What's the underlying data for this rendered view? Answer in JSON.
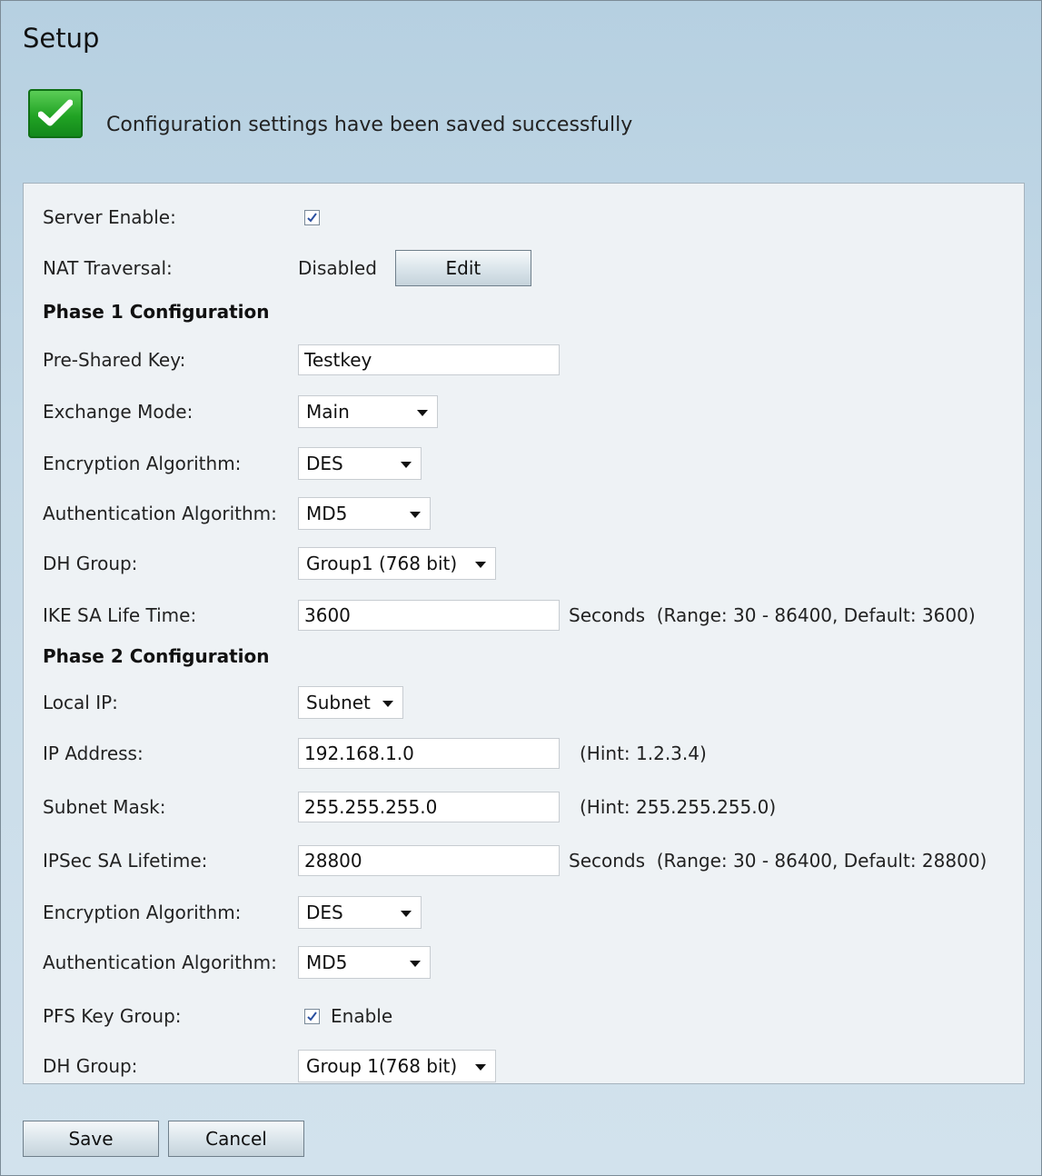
{
  "page": {
    "title": "Setup"
  },
  "banner": {
    "message": "Configuration settings have been saved successfully",
    "icon": "check-icon"
  },
  "general": {
    "server_enable_label": "Server Enable:",
    "server_enable_checked": true,
    "nat_label": "NAT Traversal:",
    "nat_status": "Disabled",
    "nat_edit": "Edit"
  },
  "phase1": {
    "heading": "Phase 1 Configuration",
    "psk_label": "Pre-Shared Key:",
    "psk_value": "Testkey",
    "exchange_label": "Exchange Mode:",
    "exchange_value": "Main",
    "enc_label": "Encryption Algorithm:",
    "enc_value": "DES",
    "auth_label": "Authentication Algorithm:",
    "auth_value": "MD5",
    "dh_label": "DH Group:",
    "dh_value": "Group1 (768 bit)",
    "ike_label": "IKE SA Life Time:",
    "ike_value": "3600",
    "ike_hint": "Seconds  (Range: 30 - 86400, Default: 3600)"
  },
  "phase2": {
    "heading": "Phase 2 Configuration",
    "localip_label": "Local IP:",
    "localip_value": "Subnet",
    "ip_label": "IP Address:",
    "ip_value": "192.168.1.0",
    "ip_hint": "(Hint: 1.2.3.4)",
    "mask_label": "Subnet Mask:",
    "mask_value": "255.255.255.0",
    "mask_hint": "(Hint: 255.255.255.0)",
    "ipsec_label": "IPSec SA Lifetime:",
    "ipsec_value": "28800",
    "ipsec_hint": "Seconds  (Range: 30 - 86400, Default: 28800)",
    "enc_label": "Encryption Algorithm:",
    "enc_value": "DES",
    "auth_label": "Authentication Algorithm:",
    "auth_value": "MD5",
    "pfs_label": "PFS Key Group:",
    "pfs_checked": true,
    "pfs_enable": "Enable",
    "dh_label": "DH Group:",
    "dh_value": "Group 1(768 bit)"
  },
  "actions": {
    "save": "Save",
    "cancel": "Cancel"
  }
}
